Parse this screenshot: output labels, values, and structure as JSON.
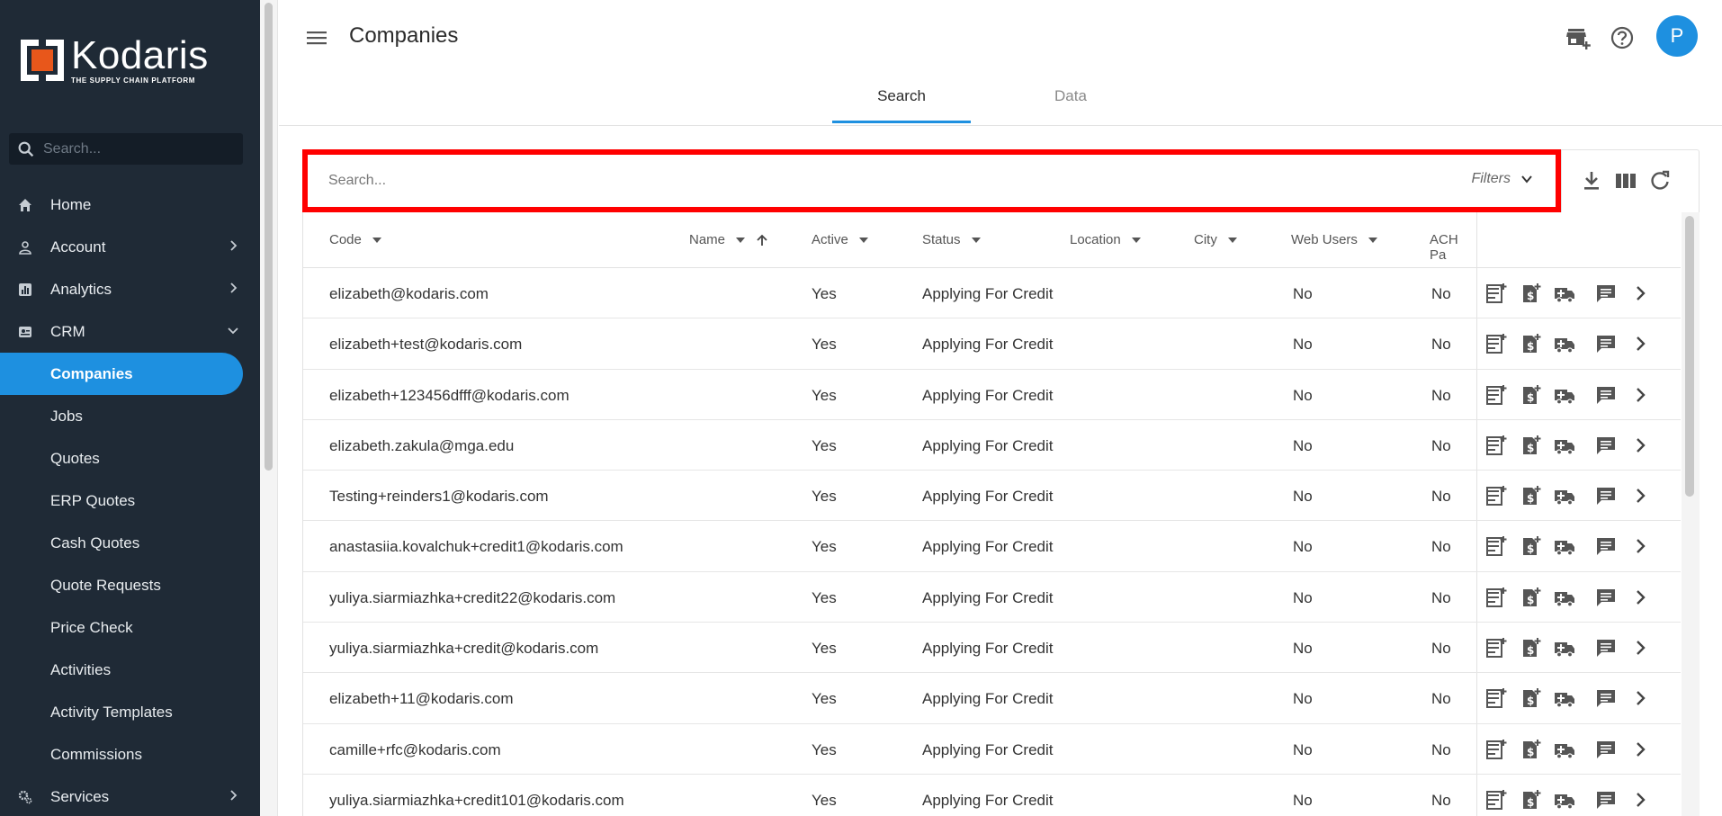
{
  "brand": {
    "name": "Kodaris",
    "tagline": "THE SUPPLY CHAIN PLATFORM",
    "accent": "#1e90e0",
    "logo_orange": "#e8571b"
  },
  "sidebar": {
    "search_placeholder": "Search...",
    "items": [
      {
        "label": "Home",
        "icon": "home-icon",
        "type": "top"
      },
      {
        "label": "Account",
        "icon": "person-icon",
        "type": "top",
        "chevron": "right"
      },
      {
        "label": "Analytics",
        "icon": "analytics-icon",
        "type": "top",
        "chevron": "right"
      },
      {
        "label": "CRM",
        "icon": "crm-icon",
        "type": "top",
        "chevron": "down"
      },
      {
        "label": "Companies",
        "type": "sub",
        "active": true
      },
      {
        "label": "Jobs",
        "type": "sub"
      },
      {
        "label": "Quotes",
        "type": "sub"
      },
      {
        "label": "ERP Quotes",
        "type": "sub"
      },
      {
        "label": "Cash Quotes",
        "type": "sub"
      },
      {
        "label": "Quote Requests",
        "type": "sub"
      },
      {
        "label": "Price Check",
        "type": "sub"
      },
      {
        "label": "Activities",
        "type": "sub"
      },
      {
        "label": "Activity Templates",
        "type": "sub"
      },
      {
        "label": "Commissions",
        "type": "sub"
      },
      {
        "label": "Services",
        "icon": "services-icon",
        "type": "top",
        "chevron": "right"
      }
    ]
  },
  "header": {
    "title": "Companies",
    "avatar_initial": "P",
    "tabs": [
      {
        "label": "Search",
        "active": true
      },
      {
        "label": "Data",
        "active": false
      }
    ]
  },
  "search": {
    "placeholder": "Search...",
    "filters_label": "Filters"
  },
  "table": {
    "columns": [
      "Code",
      "Name",
      "Active",
      "Status",
      "Location",
      "City",
      "Web Users",
      "ACH Pa"
    ],
    "rows": [
      {
        "code": "elizabeth@kodaris.com",
        "name": "",
        "active": "Yes",
        "status": "Applying For Credit",
        "location": "",
        "city": "",
        "web_users": "No",
        "ach": "No"
      },
      {
        "code": "elizabeth+test@kodaris.com",
        "name": "",
        "active": "Yes",
        "status": "Applying For Credit",
        "location": "",
        "city": "",
        "web_users": "No",
        "ach": "No"
      },
      {
        "code": "elizabeth+123456dfff@kodaris.com",
        "name": "",
        "active": "Yes",
        "status": "Applying For Credit",
        "location": "",
        "city": "",
        "web_users": "No",
        "ach": "No"
      },
      {
        "code": "elizabeth.zakula@mga.edu",
        "name": "",
        "active": "Yes",
        "status": "Applying For Credit",
        "location": "",
        "city": "",
        "web_users": "No",
        "ach": "No"
      },
      {
        "code": "Testing+reinders1@kodaris.com",
        "name": "",
        "active": "Yes",
        "status": "Applying For Credit",
        "location": "",
        "city": "",
        "web_users": "No",
        "ach": "No"
      },
      {
        "code": "anastasiia.kovalchuk+credit1@kodaris.com",
        "name": "",
        "active": "Yes",
        "status": "Applying For Credit",
        "location": "",
        "city": "",
        "web_users": "No",
        "ach": "No"
      },
      {
        "code": "yuliya.siarmiazhka+credit22@kodaris.com",
        "name": "",
        "active": "Yes",
        "status": "Applying For Credit",
        "location": "",
        "city": "",
        "web_users": "No",
        "ach": "No"
      },
      {
        "code": "yuliya.siarmiazhka+credit@kodaris.com",
        "name": "",
        "active": "Yes",
        "status": "Applying For Credit",
        "location": "",
        "city": "",
        "web_users": "No",
        "ach": "No"
      },
      {
        "code": "elizabeth+11@kodaris.com",
        "name": "",
        "active": "Yes",
        "status": "Applying For Credit",
        "location": "",
        "city": "",
        "web_users": "No",
        "ach": "No"
      },
      {
        "code": "camille+rfc@kodaris.com",
        "name": "",
        "active": "Yes",
        "status": "Applying For Credit",
        "location": "",
        "city": "",
        "web_users": "No",
        "ach": "No"
      },
      {
        "code": "yuliya.siarmiazhka+credit101@kodaris.com",
        "name": "",
        "active": "Yes",
        "status": "Applying For Credit",
        "location": "",
        "city": "",
        "web_users": "No",
        "ach": "No"
      }
    ],
    "row_actions": [
      "add-note-icon",
      "credit-icon",
      "shipping-icon",
      "message-icon",
      "chevron-right-icon"
    ]
  },
  "toolbar": {
    "icons": [
      "download-icon",
      "columns-icon",
      "refresh-icon"
    ]
  }
}
